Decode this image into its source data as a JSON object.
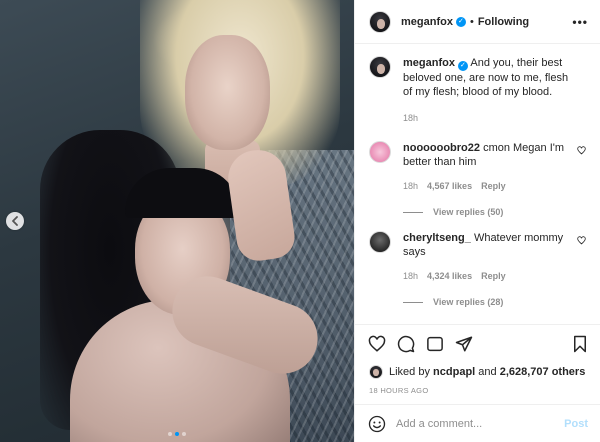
{
  "post": {
    "author": "meganfox",
    "separator": "•",
    "follow_status": "Following",
    "more_icon": "more-horizontal-icon"
  },
  "caption": {
    "author": "meganfox",
    "text": "And you, their best beloved one, are now to me, flesh of my flesh; blood of my blood.",
    "time": "18h"
  },
  "comments": [
    {
      "user": "noooooobro22",
      "text": "cmon Megan I'm better than him",
      "time": "18h",
      "likes": "4,567 likes",
      "reply_label": "Reply",
      "view_replies": "View replies (50)"
    },
    {
      "user": "cherylt­seng_",
      "text": "Whatever mommy says",
      "time": "18h",
      "likes": "4,324 likes",
      "reply_label": "Reply",
      "view_replies": "View replies (28)"
    }
  ],
  "likes": {
    "prefix": "Liked by",
    "user": "ncdpapl",
    "conjunction": "and",
    "count": "2,628,707 others"
  },
  "timestamp": "18 HOURS AGO",
  "add_comment": {
    "placeholder": "Add a comment...",
    "post_label": "Post"
  },
  "carousel": {
    "total_slides": 3,
    "active_slide": 2
  },
  "colors": {
    "accent": "#0095f6",
    "post_disabled": "#b2dffc",
    "muted_text": "#8e8e8e"
  }
}
